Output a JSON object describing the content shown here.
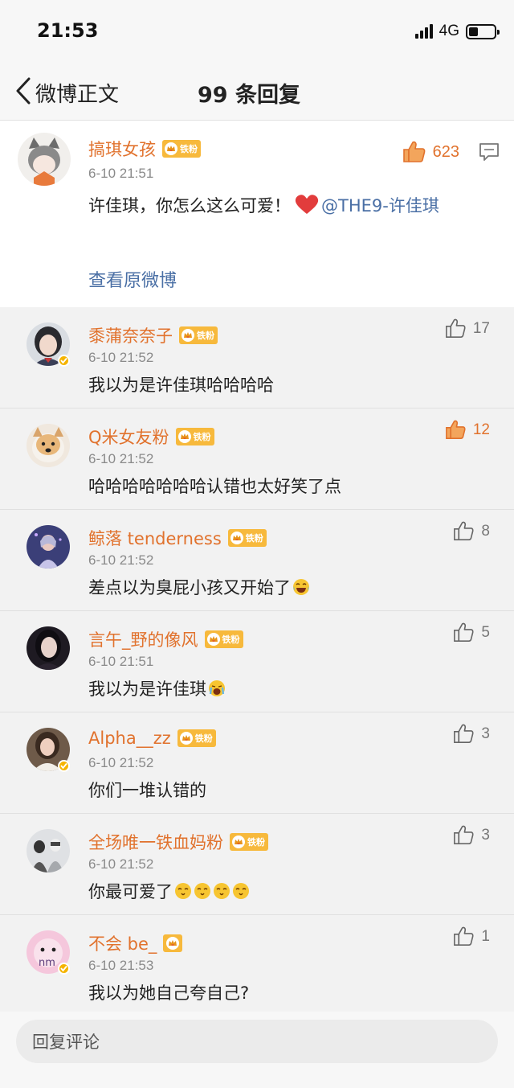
{
  "status": {
    "time": "21:53",
    "network": "4G"
  },
  "nav": {
    "back_label": "微博正文",
    "title": "99 条回复"
  },
  "main_comment": {
    "user": "搞琪女孩",
    "fan_badge": "铁粉",
    "time": "6-10 21:51",
    "text": "许佳琪，你怎么这么可爱！",
    "mention": "@THE9-许佳琪",
    "likes": "623",
    "view_original": "查看原微博"
  },
  "replies": [
    {
      "user": "黍蒲奈奈子",
      "badge": "铁粉",
      "time": "6-10 21:52",
      "text": "我以为是许佳琪哈哈哈哈",
      "likes": "17",
      "hot": false
    },
    {
      "user": "Q米女友粉",
      "badge": "铁粉",
      "time": "6-10 21:52",
      "text": "哈哈哈哈哈哈哈认错也太好笑了点",
      "likes": "12",
      "hot": true
    },
    {
      "user": "鲸落 tenderness",
      "badge": "铁粉",
      "time": "6-10 21:52",
      "text": "差点以为臭屁小孩又开始了",
      "likes": "8",
      "hot": false
    },
    {
      "user": "言午_野的像风",
      "badge": "铁粉",
      "time": "6-10 21:51",
      "text": "我以为是许佳琪",
      "likes": "5",
      "hot": false
    },
    {
      "user": "Alpha__zz",
      "badge": "铁粉",
      "time": "6-10 21:52",
      "text": "你们一堆认错的",
      "likes": "3",
      "hot": false
    },
    {
      "user": "全场唯一铁血妈粉",
      "badge": "铁粉",
      "time": "6-10 21:52",
      "text": "你最可爱了",
      "likes": "3",
      "hot": false
    },
    {
      "user": "不会 be_",
      "badge": "",
      "time": "6-10 21:53",
      "text": "我以为她自己夸自己?",
      "likes": "1",
      "hot": false
    }
  ],
  "bottom": {
    "placeholder": "回复评论"
  },
  "colors": {
    "accent": "#e1722d",
    "link": "#4a6fa5",
    "badge": "#f7b93c"
  }
}
